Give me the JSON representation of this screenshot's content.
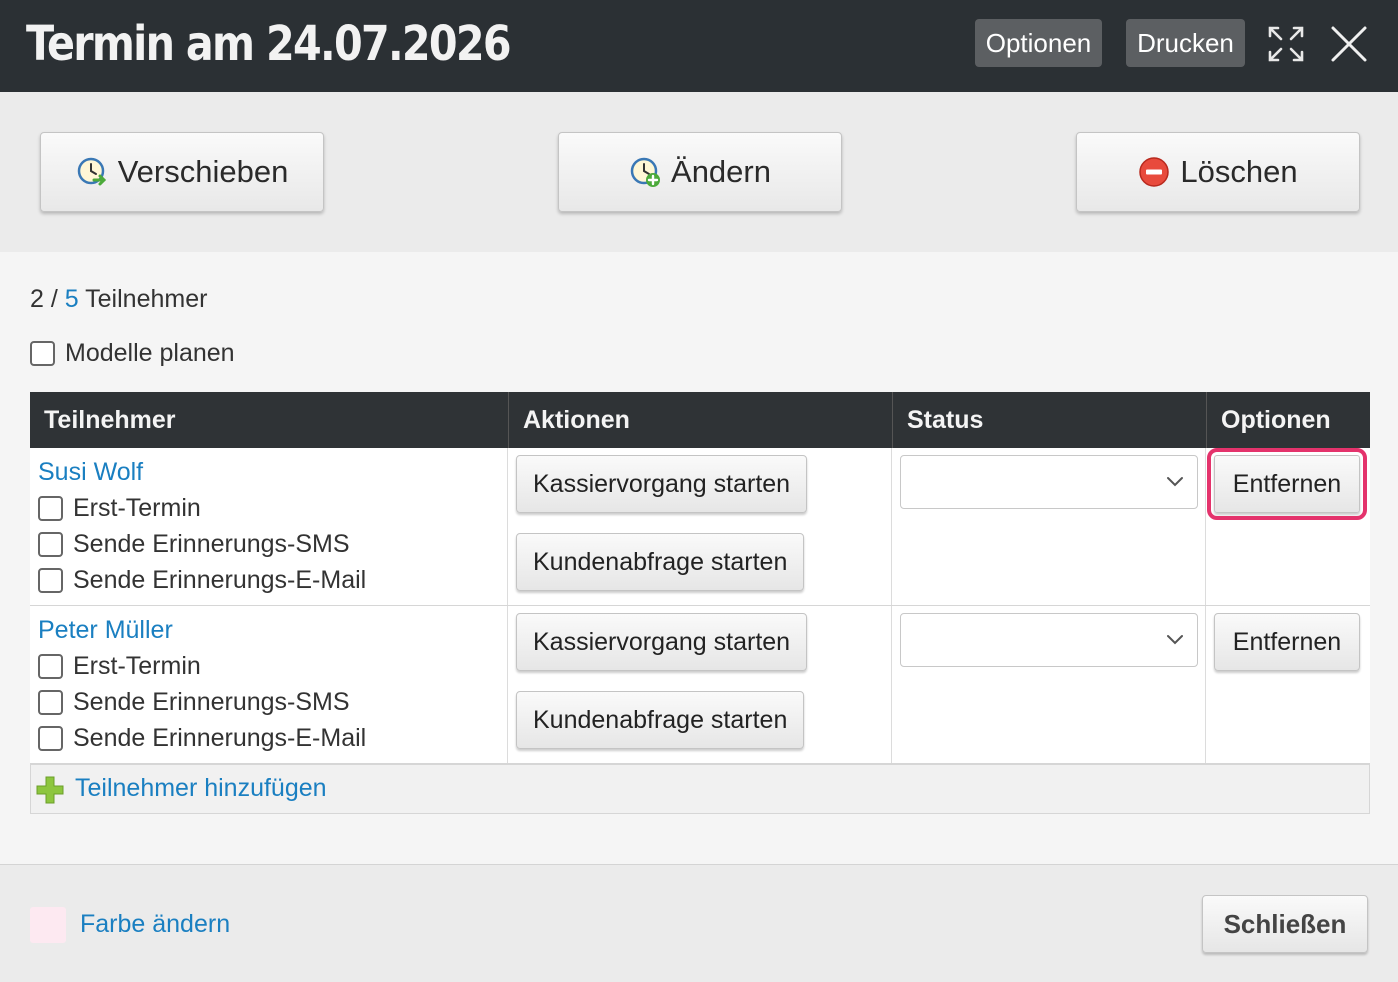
{
  "window": {
    "title": "Termin am 24.07.2026",
    "options_label": "Optionen",
    "print_label": "Drucken",
    "expand_icon": "expand-icon",
    "close_icon": "close-icon"
  },
  "toolbar": {
    "shift_label": "Verschieben",
    "change_label": "Ändern",
    "delete_label": "Löschen"
  },
  "participants_count": {
    "current": "2",
    "separator": " / ",
    "total": "5",
    "label": " Teilnehmer"
  },
  "plan_models_label": "Modelle planen",
  "table": {
    "headers": [
      "Teilnehmer",
      "Aktionen",
      "Status",
      "Optionen"
    ],
    "rows": [
      {
        "name": "Susi Wolf",
        "options": [
          "Erst-Termin",
          "Sende Erinnerungs-SMS",
          "Sende Erinnerungs-E-Mail"
        ],
        "action1": "Kassiervorgang starten",
        "action2": "Kundenabfrage starten",
        "status": "",
        "remove_label": "Entfernen"
      },
      {
        "name": "Peter Müller",
        "options": [
          "Erst-Termin",
          "Sende Erinnerungs-SMS",
          "Sende Erinnerungs-E-Mail"
        ],
        "action1": "Kassiervorgang starten",
        "action2": "Kundenabfrage starten",
        "status": "",
        "remove_label": "Entfernen"
      }
    ],
    "add_label": "Teilnehmer hinzufügen"
  },
  "footer": {
    "color_label": "Farbe ändern",
    "swatch_color": "#fde9f1",
    "close_label": "Schließen"
  },
  "colors": {
    "header_bg": "#2b3034",
    "link": "#1a7fc1",
    "highlight": "#e4336c"
  }
}
